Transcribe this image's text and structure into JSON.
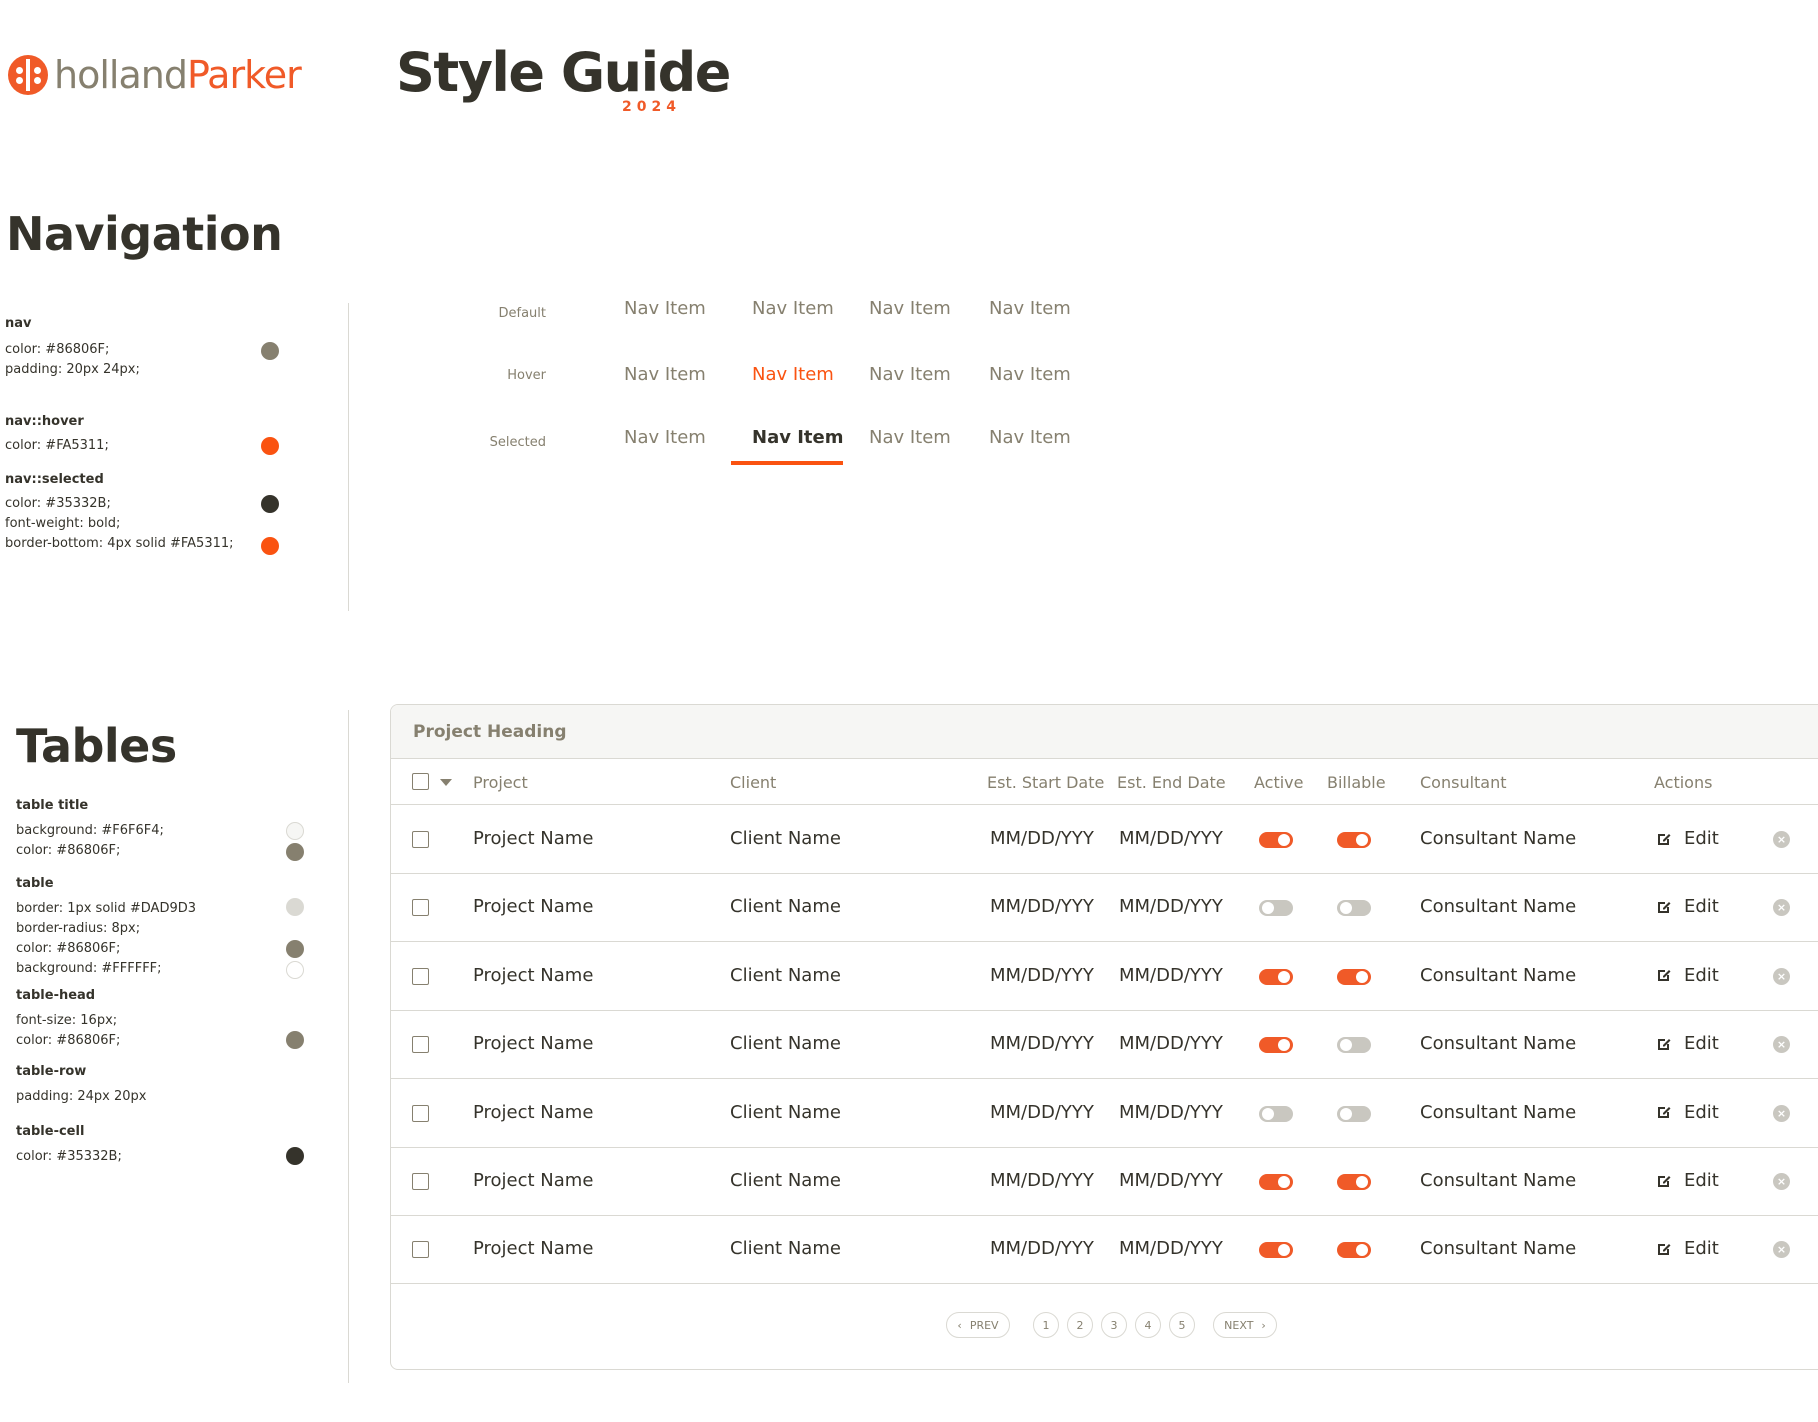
{
  "header": {
    "logo_text_a": "holland",
    "logo_text_b": "Parker",
    "title": "Style Guide",
    "year": "2024"
  },
  "navigation": {
    "title": "Navigation",
    "specs": {
      "nav_label": "nav",
      "nav_color": "color: #86806F;",
      "nav_padding": "padding: 20px 24px;",
      "hover_label": "nav::hover",
      "hover_color": "color: #FA5311;",
      "selected_label": "nav::selected",
      "selected_color": "color: #35332B;",
      "selected_weight": "font-weight: bold;",
      "selected_border": "border-bottom: 4px solid #FA5311;"
    },
    "swatches": {
      "nav": "#86806F",
      "hover": "#FA5311",
      "selected": "#35332B",
      "border": "#FA5311"
    },
    "rows": [
      {
        "label": "Default",
        "items": [
          "Nav Item",
          "Nav Item",
          "Nav Item",
          "Nav Item"
        ]
      },
      {
        "label": "Hover",
        "items": [
          "Nav Item",
          "Nav Item",
          "Nav Item",
          "Nav Item"
        ]
      },
      {
        "label": "Selected",
        "items": [
          "Nav Item",
          "Nav Item",
          "Nav Item",
          "Nav Item"
        ]
      }
    ]
  },
  "tables": {
    "title": "Tables",
    "specs": {
      "title_label": "table title",
      "title_bg": "background: #F6F6F4;",
      "title_color": "color: #86806F;",
      "table_label": "table",
      "table_border": "border: 1px solid #DAD9D3",
      "table_radius": "border-radius:  8px;",
      "table_color": "color: #86806F;",
      "table_bg": "background: #FFFFFF;",
      "head_label": "table-head",
      "head_size": "font-size: 16px;",
      "head_color": "color: #86806F;",
      "row_label": "table-row",
      "row_padding": "padding: 24px 20px",
      "cell_label": "table-cell",
      "cell_color": "color: #35332B;"
    },
    "swatches": {
      "title_bg": "#F6F6F4",
      "title_color": "#86806F",
      "table_border": "#DAD9D3",
      "table_color": "#86806F",
      "table_bg": "#FFFFFF",
      "head_color": "#86806F",
      "cell_color": "#35332B"
    }
  },
  "project_table": {
    "heading": "Project Heading",
    "columns": [
      "Project",
      "Client",
      "Est. Start Date",
      "Est. End Date",
      "Active",
      "Billable",
      "Consultant",
      "Actions"
    ],
    "edit_label": "Edit",
    "rows": [
      {
        "project": "Project Name",
        "client": "Client Name",
        "start": "MM/DD/YYY",
        "end": "MM/DD/YYY",
        "active": true,
        "billable": true,
        "consultant": "Consultant Name"
      },
      {
        "project": "Project Name",
        "client": "Client Name",
        "start": "MM/DD/YYY",
        "end": "MM/DD/YYY",
        "active": false,
        "billable": false,
        "consultant": "Consultant Name"
      },
      {
        "project": "Project Name",
        "client": "Client Name",
        "start": "MM/DD/YYY",
        "end": "MM/DD/YYY",
        "active": true,
        "billable": true,
        "consultant": "Consultant Name"
      },
      {
        "project": "Project Name",
        "client": "Client Name",
        "start": "MM/DD/YYY",
        "end": "MM/DD/YYY",
        "active": true,
        "billable": false,
        "consultant": "Consultant Name"
      },
      {
        "project": "Project Name",
        "client": "Client Name",
        "start": "MM/DD/YYY",
        "end": "MM/DD/YYY",
        "active": false,
        "billable": false,
        "consultant": "Consultant Name"
      },
      {
        "project": "Project Name",
        "client": "Client Name",
        "start": "MM/DD/YYY",
        "end": "MM/DD/YYY",
        "active": true,
        "billable": true,
        "consultant": "Consultant Name"
      },
      {
        "project": "Project Name",
        "client": "Client Name",
        "start": "MM/DD/YYY",
        "end": "MM/DD/YYY",
        "active": true,
        "billable": true,
        "consultant": "Consultant Name"
      }
    ],
    "pagination": {
      "prev": "PREV",
      "next": "NEXT",
      "pages": [
        "1",
        "2",
        "3",
        "4",
        "5"
      ]
    }
  }
}
